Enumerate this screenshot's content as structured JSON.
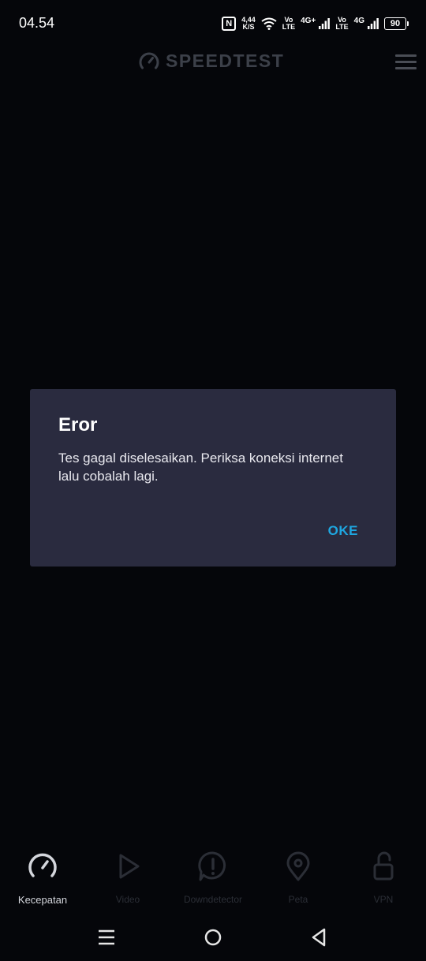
{
  "status_bar": {
    "time": "04.54",
    "nfc_label": "N",
    "net_speed_value": "4,44",
    "net_speed_unit": "K/S",
    "sim1": {
      "vo": "Vo",
      "lte": "LTE",
      "gen": "4G+"
    },
    "sim2": {
      "vo": "Vo",
      "lte": "LTE",
      "gen": "4G"
    },
    "battery_level": "90"
  },
  "header": {
    "logo_text": "SPEEDTEST"
  },
  "dialog": {
    "title": "Eror",
    "message": "Tes gagal diselesaikan. Periksa koneksi internet lalu cobalah lagi.",
    "ok_label": "OKE"
  },
  "tabs": [
    {
      "label": "Kecepatan",
      "icon": "speedometer-icon",
      "active": true
    },
    {
      "label": "Video",
      "icon": "play-icon",
      "active": false
    },
    {
      "label": "Downdetector",
      "icon": "alert-icon",
      "active": false
    },
    {
      "label": "Peta",
      "icon": "map-pin-icon",
      "active": false
    },
    {
      "label": "VPN",
      "icon": "lock-icon",
      "active": false
    }
  ],
  "colors": {
    "background": "#05060a",
    "dialog_bg": "#2a2b3f",
    "accent": "#1ea7e1",
    "active_tab": "#d4d6dc",
    "inactive_tab": "#2b2e36"
  }
}
